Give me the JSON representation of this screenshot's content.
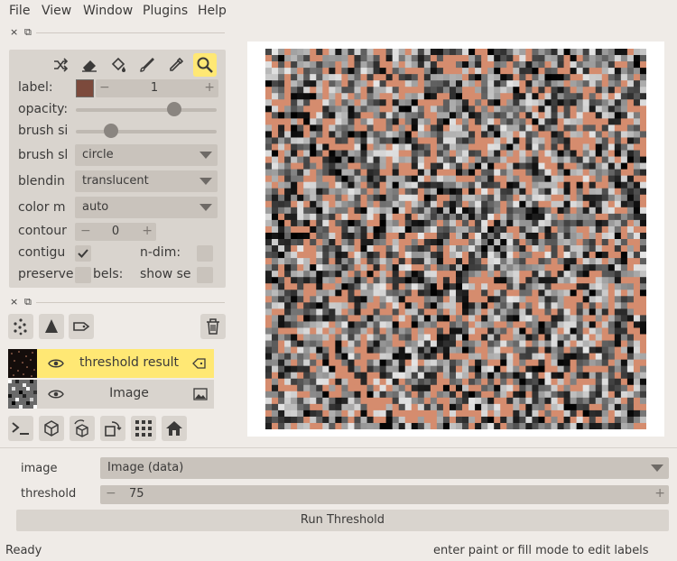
{
  "menu": {
    "file": "File",
    "view": "View",
    "window": "Window",
    "plugins": "Plugins",
    "help": "Help"
  },
  "dock_controls": {
    "close": "×",
    "float": "⧉"
  },
  "layer_controls": {
    "label_label": "label:",
    "label_value": "1",
    "label_color": "#7c4a3c",
    "opacity_label": "opacity:",
    "opacity_value": 0.7,
    "brush_size_label": "brush si",
    "brush_size_value": 0.25,
    "brush_shape_label": "brush sl",
    "brush_shape_value": "circle",
    "blending_label": "blendin",
    "blending_value": "translucent",
    "color_mode_label": "color m",
    "color_mode_value": "auto",
    "contour_label": "contour",
    "contour_value": "0",
    "contiguous_label": "contigu",
    "contiguous_checked": true,
    "ndim_label": "n-dim:",
    "preserve_label": "preserve",
    "preserve_suffix": "bels:",
    "show_selected_label": "show se",
    "spin_minus": "−",
    "spin_plus": "+"
  },
  "layers": [
    {
      "name": "threshold result",
      "selected": true
    },
    {
      "name": "Image",
      "selected": false
    }
  ],
  "widget": {
    "image_label": "image",
    "image_value": "Image (data)",
    "threshold_label": "threshold",
    "threshold_value": "75",
    "run_label": "Run Threshold"
  },
  "status": {
    "left": "Ready",
    "right": "enter paint or fill mode to edit labels"
  },
  "colors": {
    "accent": "#ffe874",
    "panel": "#d9d4ce",
    "label_salmon": "#d58c6e"
  }
}
